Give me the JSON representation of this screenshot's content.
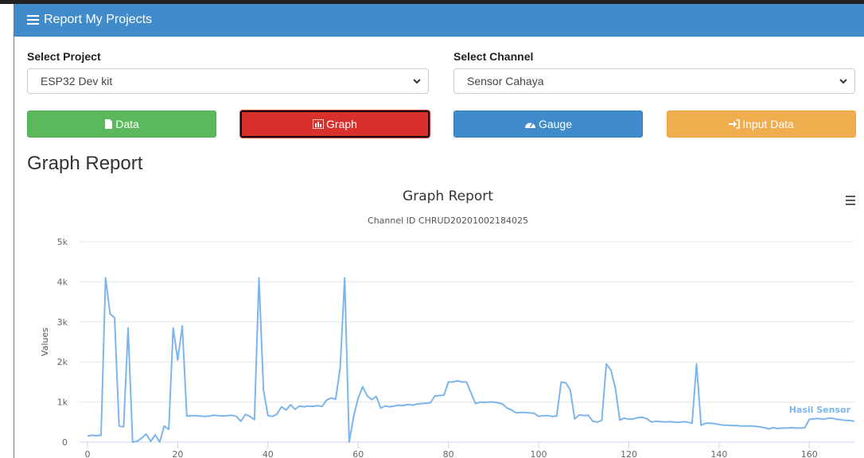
{
  "panel": {
    "title": "Report My Projects"
  },
  "project": {
    "label": "Select Project",
    "value": "ESP32 Dev kit"
  },
  "channel": {
    "label": "Select Channel",
    "value": "Sensor Cahaya"
  },
  "buttons": {
    "data": "Data",
    "graph": "Graph",
    "gauge": "Gauge",
    "input": "Input Data"
  },
  "section_title": "Graph Report",
  "colors": {
    "primary": "#428bca",
    "success": "#5cb85c",
    "danger": "#d9302b",
    "warning": "#f0ad4e",
    "series": "#7cb5ec"
  },
  "chart_data": {
    "type": "line",
    "title": "Graph Report",
    "subtitle": "Channel ID CHRUD20201002184025",
    "xlabel": "",
    "ylabel": "Values",
    "xlim": [
      0,
      170
    ],
    "ylim": [
      0,
      5000
    ],
    "x_ticks": [
      "0",
      "20",
      "40",
      "60",
      "80",
      "100",
      "120",
      "140",
      "160"
    ],
    "y_ticks": [
      "0",
      "1k",
      "2k",
      "3k",
      "4k",
      "5k"
    ],
    "grid": true,
    "series": [
      {
        "name": "Hasil Sensor",
        "x": [
          0,
          1,
          2,
          3,
          4,
          5,
          6,
          7,
          8,
          9,
          10,
          11,
          12,
          13,
          14,
          15,
          16,
          17,
          18,
          19,
          20,
          21,
          22,
          23,
          24,
          25,
          26,
          27,
          28,
          29,
          30,
          31,
          32,
          33,
          34,
          35,
          36,
          37,
          38,
          39,
          40,
          41,
          42,
          43,
          44,
          45,
          46,
          47,
          48,
          49,
          50,
          51,
          52,
          53,
          54,
          55,
          56,
          57,
          58,
          59,
          60,
          61,
          62,
          63,
          64,
          65,
          66,
          67,
          68,
          69,
          70,
          71,
          72,
          73,
          74,
          75,
          76,
          77,
          78,
          79,
          80,
          81,
          82,
          83,
          84,
          85,
          86,
          87,
          88,
          89,
          90,
          91,
          92,
          93,
          94,
          95,
          96,
          97,
          98,
          99,
          100,
          101,
          102,
          103,
          104,
          105,
          106,
          107,
          108,
          109,
          110,
          111,
          112,
          113,
          114,
          115,
          116,
          117,
          118,
          119,
          120,
          121,
          122,
          123,
          124,
          125,
          126,
          127,
          128,
          129,
          130,
          131,
          132,
          133,
          134,
          135,
          136,
          137,
          138,
          139,
          140,
          141,
          142,
          143,
          144,
          145,
          146,
          147,
          148,
          149,
          150,
          151,
          152,
          153,
          154,
          155,
          156,
          157,
          158,
          159,
          160,
          161,
          162,
          163,
          164,
          165,
          166,
          167,
          168,
          169,
          170
        ],
        "y": [
          150,
          170,
          160,
          170,
          4100,
          3200,
          3100,
          400,
          380,
          2850,
          0,
          20,
          100,
          200,
          20,
          180,
          0,
          400,
          320,
          2850,
          2050,
          2900,
          650,
          660,
          660,
          650,
          640,
          650,
          670,
          660,
          650,
          660,
          670,
          640,
          520,
          690,
          640,
          560,
          4100,
          1300,
          660,
          640,
          700,
          880,
          800,
          930,
          820,
          900,
          880,
          900,
          890,
          910,
          890,
          1050,
          1100,
          1070,
          1850,
          4100,
          0,
          650,
          1100,
          1380,
          1150,
          1060,
          1140,
          850,
          900,
          880,
          900,
          920,
          910,
          940,
          920,
          950,
          960,
          970,
          980,
          1150,
          1160,
          1170,
          1500,
          1500,
          1530,
          1500,
          1500,
          1230,
          960,
          1000,
          990,
          1000,
          1000,
          980,
          950,
          850,
          800,
          730,
          740,
          740,
          730,
          720,
          640,
          660,
          660,
          640,
          650,
          1500,
          1480,
          1300,
          580,
          680,
          660,
          670,
          520,
          500,
          540,
          1950,
          1800,
          1350,
          550,
          600,
          570,
          580,
          610,
          620,
          580,
          500,
          520,
          510,
          500,
          510,
          500,
          490,
          510,
          500,
          470,
          1950,
          420,
          470,
          470,
          460,
          440,
          420,
          420,
          410,
          410,
          400,
          400,
          400,
          390,
          380,
          360,
          330,
          360,
          340,
          350,
          350,
          360,
          350,
          350,
          360,
          570,
          580,
          590,
          570,
          590,
          600,
          570,
          560,
          540,
          540,
          520
        ]
      }
    ]
  }
}
